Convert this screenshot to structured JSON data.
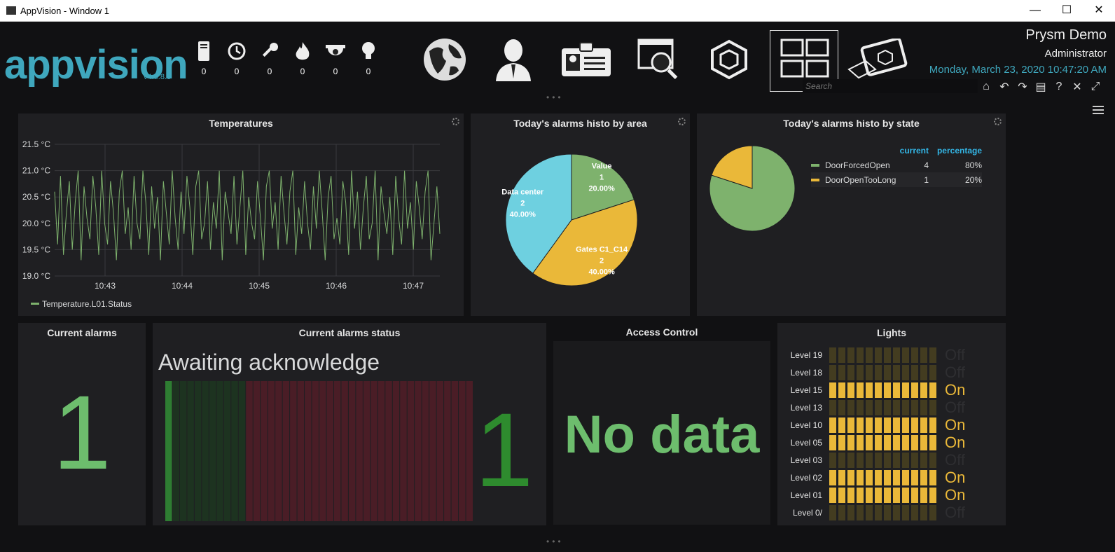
{
  "window": {
    "title": "AppVision - Window 1",
    "min": "—",
    "max": "☐",
    "close": "✕"
  },
  "brand": {
    "logo": "appvision",
    "version": "v4.5.8.0"
  },
  "counters": [
    {
      "icon": "server-icon",
      "value": "0"
    },
    {
      "icon": "history-icon",
      "value": "0"
    },
    {
      "icon": "key-icon",
      "value": "0"
    },
    {
      "icon": "fire-icon",
      "value": "0"
    },
    {
      "icon": "camera-icon",
      "value": "0"
    },
    {
      "icon": "lightbulb-icon",
      "value": "0"
    }
  ],
  "user": {
    "name": "Prysm Demo",
    "role": "Administrator",
    "datetime": "Monday, March 23, 2020 10:47:20 AM"
  },
  "search": {
    "placeholder": "Search"
  },
  "panels": {
    "temperatures": {
      "title": "Temperatures"
    },
    "area": {
      "title": "Today's alarms histo by area"
    },
    "state": {
      "title": "Today's alarms histo by state"
    },
    "current_alarms": {
      "title": "Current alarms",
      "value": "1"
    },
    "alarms_status": {
      "title": "Current alarms status",
      "state": "Awaiting acknowledge",
      "value": "1"
    },
    "access_control": {
      "title": "Access Control",
      "value": "No data"
    },
    "lights": {
      "title": "Lights",
      "rows": [
        {
          "label": "Level 19",
          "state": "Off",
          "on": false
        },
        {
          "label": "Level 18",
          "state": "Off",
          "on": false
        },
        {
          "label": "Level 15",
          "state": "On",
          "on": true
        },
        {
          "label": "Level 13",
          "state": "Off",
          "on": false
        },
        {
          "label": "Level 10",
          "state": "On",
          "on": true
        },
        {
          "label": "Level 05",
          "state": "On",
          "on": true
        },
        {
          "label": "Level 03",
          "state": "Off",
          "on": false
        },
        {
          "label": "Level 02",
          "state": "On",
          "on": true
        },
        {
          "label": "Level 01",
          "state": "On",
          "on": true
        },
        {
          "label": "Level 0/",
          "state": "Off",
          "on": false
        }
      ]
    }
  },
  "colors": {
    "green": "#7eb26d",
    "yellow": "#eab839",
    "cyan": "#6ed0e0",
    "brand": "#3fa7bd",
    "bignumber": "#6dbd6d"
  },
  "chart_data": [
    {
      "type": "line",
      "title": "Temperatures",
      "x_ticks": [
        "10:43",
        "10:44",
        "10:45",
        "10:46",
        "10:47"
      ],
      "y_ticks": [
        "21.5 °C",
        "21.0 °C",
        "20.5 °C",
        "20.0 °C",
        "19.5 °C",
        "19.0 °C"
      ],
      "ylim": [
        19.0,
        21.5
      ],
      "grid": true,
      "legend_position": "bottom-left",
      "series": [
        {
          "name": "Temperature.L01.Status",
          "color": "#7eb26d",
          "values": [
            20.6,
            19.6,
            20.9,
            19.4,
            20.2,
            20.8,
            19.5,
            20.4,
            21.0,
            19.3,
            20.7,
            20.1,
            19.7,
            20.9,
            20.3,
            19.4,
            21.0,
            20.0,
            19.6,
            20.8,
            20.2,
            19.3,
            20.6,
            21.0,
            19.8,
            20.3,
            19.5,
            20.9,
            20.0,
            19.7,
            21.0,
            20.4,
            19.4,
            20.7,
            19.9,
            20.5,
            19.3,
            20.8,
            20.2,
            19.6,
            21.0,
            20.1,
            19.5,
            20.6,
            19.8,
            20.9,
            20.3,
            19.4,
            20.7,
            21.0,
            19.7,
            20.0,
            20.8,
            19.5,
            20.4,
            19.9,
            21.0,
            19.3,
            20.6,
            20.2,
            19.8,
            20.9,
            19.6,
            20.3,
            21.0,
            19.4,
            20.5,
            20.0,
            19.7,
            20.8,
            20.1,
            19.3,
            20.7,
            21.0,
            19.9,
            20.4,
            19.5,
            20.9,
            20.2,
            19.6,
            20.6,
            21.0,
            19.4,
            20.3,
            19.8,
            20.8,
            20.0,
            19.5,
            20.7,
            19.9,
            21.0,
            20.2,
            19.3,
            20.5,
            20.9,
            19.7,
            20.1,
            19.6,
            20.8,
            20.4,
            19.4,
            21.0,
            19.9,
            20.6,
            19.5,
            20.3,
            20.9,
            19.7,
            20.0,
            21.0,
            19.3,
            20.7,
            20.2,
            19.8,
            20.5,
            19.4,
            20.9,
            20.1,
            19.6,
            21.0,
            19.9,
            20.4,
            19.5,
            20.8,
            20.3,
            19.7,
            20.6,
            21.0,
            19.3,
            20.0,
            20.7,
            19.8
          ]
        }
      ]
    },
    {
      "type": "pie",
      "title": "Today's alarms histo by area",
      "slices": [
        {
          "label": "Value",
          "value": 1,
          "percent": "20.00%",
          "color": "#7eb26d"
        },
        {
          "label": "Gates C1_C14",
          "value": 2,
          "percent": "40.00%",
          "color": "#eab839"
        },
        {
          "label": "Data center",
          "value": 2,
          "percent": "40.00%",
          "color": "#6ed0e0"
        }
      ]
    },
    {
      "type": "pie",
      "title": "Today's alarms histo by state",
      "legend_header": {
        "current": "current",
        "percentage": "percentage"
      },
      "slices": [
        {
          "label": "DoorForcedOpen",
          "value": 4,
          "percent": "80%",
          "color": "#7eb26d"
        },
        {
          "label": "DoorOpenTooLong",
          "value": 1,
          "percent": "20%",
          "color": "#eab839"
        }
      ]
    },
    {
      "type": "bar",
      "title": "Current alarms status",
      "bars": 42,
      "green_bars": 11
    }
  ]
}
